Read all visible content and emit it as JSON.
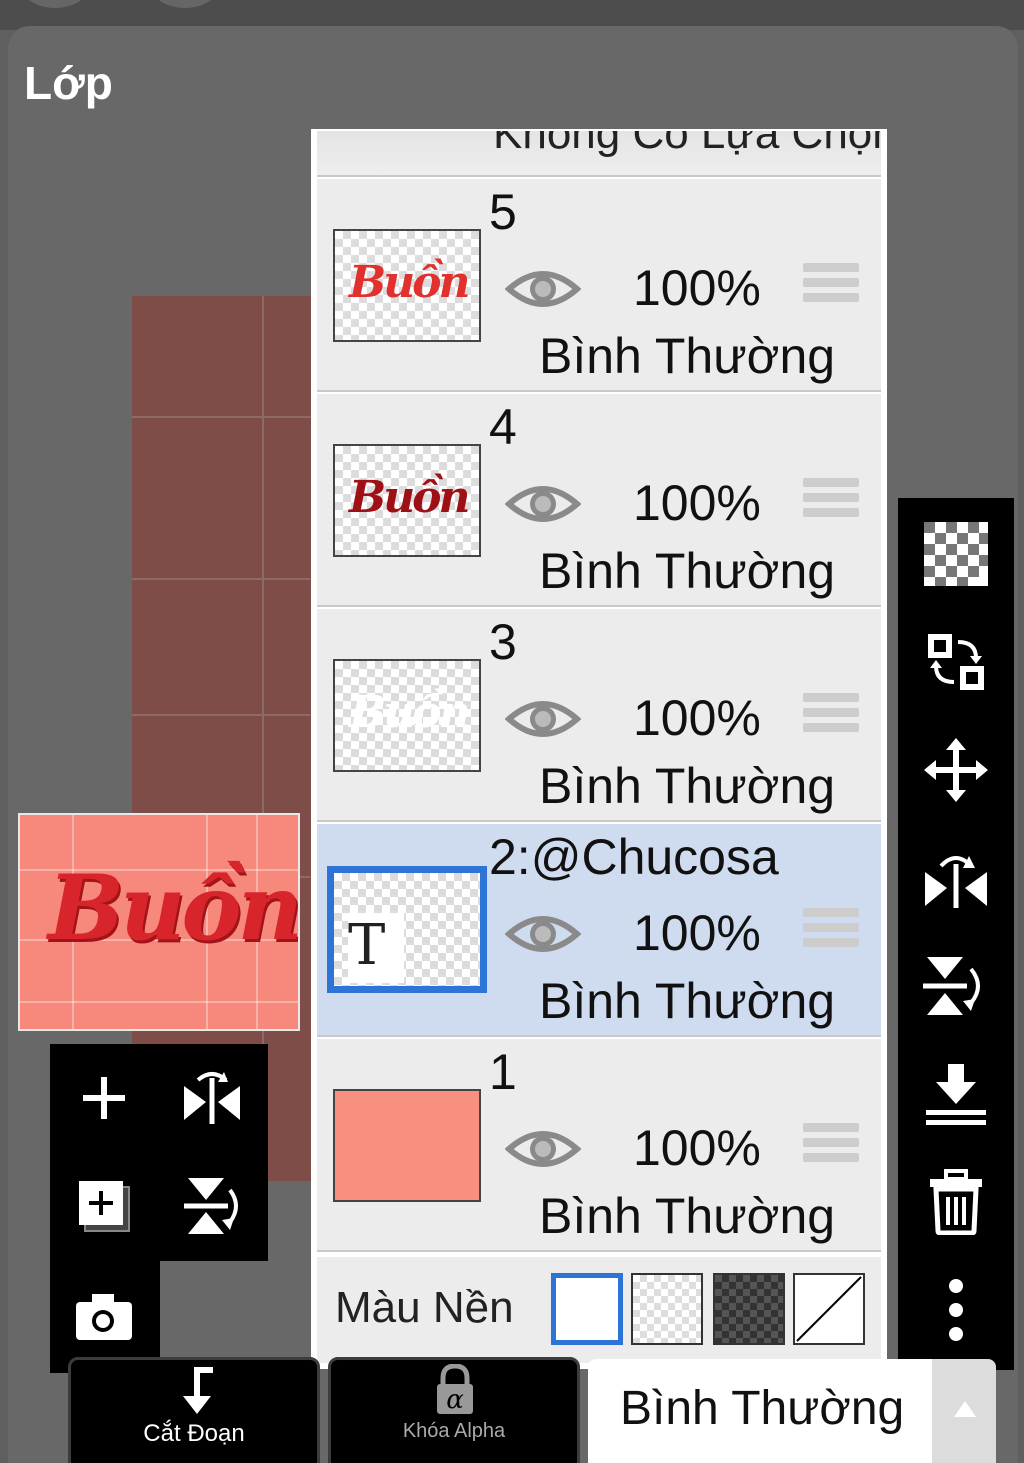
{
  "panel": {
    "title": "Lớp"
  },
  "list_header": {
    "text": "Không Có Lựa Chọn"
  },
  "layers": [
    {
      "name": "5",
      "opacity": "100%",
      "blend": "Bình Thường",
      "thumb": "Buồn",
      "thumb_color": "#e0312f",
      "selected": false
    },
    {
      "name": "4",
      "opacity": "100%",
      "blend": "Bình Thường",
      "thumb": "Buồn",
      "thumb_color": "#9e1016",
      "selected": false
    },
    {
      "name": "3",
      "opacity": "100%",
      "blend": "Bình Thường",
      "thumb": "Buồn",
      "thumb_color": "#ffffff",
      "selected": false
    },
    {
      "name": "2:@Chucosa",
      "opacity": "100%",
      "blend": "Bình Thường",
      "thumb": "T",
      "selected": true
    },
    {
      "name": "1",
      "opacity": "100%",
      "blend": "Bình Thường",
      "thumb": "",
      "thumb_color": "#f7907f",
      "selected": false
    }
  ],
  "background": {
    "label": "Màu Nền",
    "selected": "white"
  },
  "preview": {
    "word": "Buồn",
    "color": "#f6897b"
  },
  "bottom": {
    "clip_label": "Cắt Đoạn",
    "alpha_lock_label": "Khóa Alpha",
    "blend_mode": "Bình Thường"
  },
  "icons": {
    "left": [
      "add-layer-icon",
      "flip-horizontal-icon",
      "duplicate-layer-icon",
      "flip-vertical-icon",
      "camera-icon"
    ],
    "right": [
      "transparency-icon",
      "swap-icon",
      "move-icon",
      "flip-h-rotate-icon",
      "flip-v-rotate-icon",
      "merge-down-icon",
      "trash-icon",
      "more-icon"
    ]
  },
  "colors": {
    "selection": "#2e74d6",
    "selected_row": "#cfdcef",
    "panel": "#686868"
  }
}
